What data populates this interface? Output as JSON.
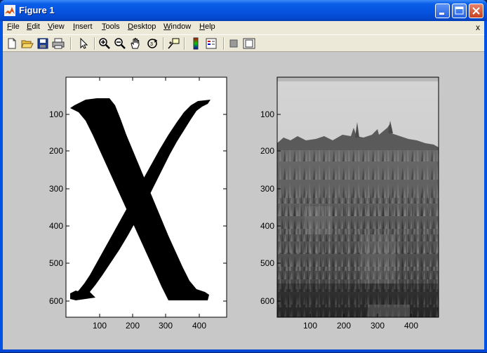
{
  "window": {
    "title": "Figure 1",
    "app_icon": "matlab-icon",
    "controls": [
      "minimize-icon",
      "maximize-icon",
      "close-icon"
    ]
  },
  "menubar": {
    "items": [
      {
        "label": "File",
        "accel": "F",
        "rest": "ile"
      },
      {
        "label": "Edit",
        "accel": "E",
        "rest": "dit"
      },
      {
        "label": "View",
        "accel": "V",
        "rest": "iew"
      },
      {
        "label": "Insert",
        "accel": "I",
        "rest": "nsert"
      },
      {
        "label": "Tools",
        "accel": "T",
        "rest": "ools"
      },
      {
        "label": "Desktop",
        "accel": "D",
        "rest": "esktop"
      },
      {
        "label": "Window",
        "accel": "W",
        "rest": "indow"
      },
      {
        "label": "Help",
        "accel": "H",
        "rest": "elp"
      }
    ],
    "doc_close": "x"
  },
  "toolbar": {
    "tools": [
      "new-figure-icon",
      "open-file-icon",
      "save-icon",
      "print-icon",
      "select-arrow-icon",
      "zoom-in-icon",
      "zoom-out-icon",
      "pan-hand-icon",
      "rotate-3d-icon",
      "data-cursor-icon",
      "colorbar-icon",
      "legend-icon",
      "hide-plot-tools-icon",
      "show-plot-tools-icon"
    ]
  },
  "figure": {
    "background": "#c8c8c8",
    "axes": [
      {
        "content": "binary image of letter X",
        "xticks": [
          "100",
          "200",
          "300",
          "400"
        ],
        "yticks": [
          "100",
          "200",
          "300",
          "400",
          "500",
          "600"
        ]
      },
      {
        "content": "grayscale photo of grass field and sky",
        "xticks": [
          "100",
          "200",
          "300",
          "400"
        ],
        "yticks": [
          "100",
          "200",
          "300",
          "400",
          "500",
          "600"
        ]
      }
    ]
  }
}
